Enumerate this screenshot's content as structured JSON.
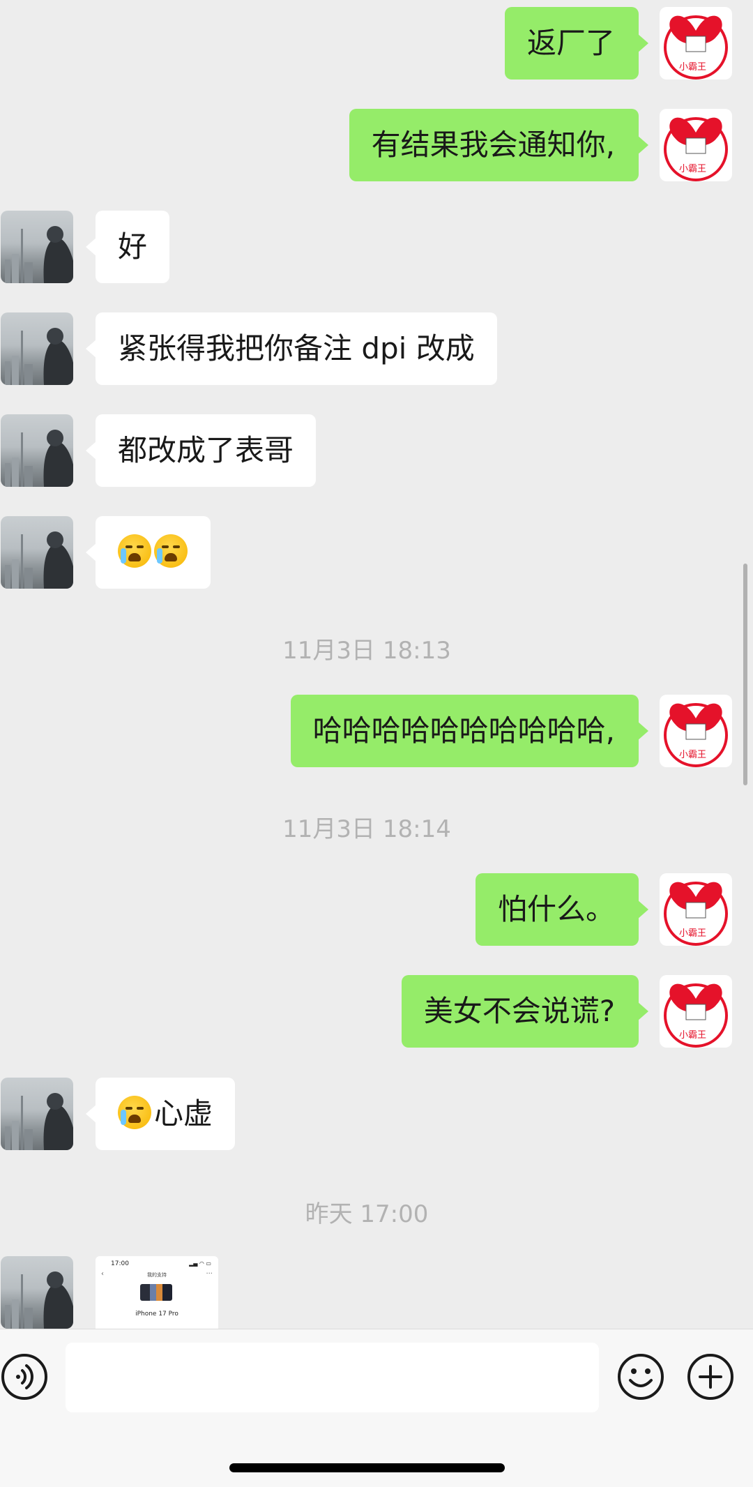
{
  "messages": [
    {
      "text": "返厂了"
    },
    {
      "text": "有结果我会通知你,"
    },
    {
      "text": "好"
    },
    {
      "text": "紧张得我把你备注 dpi 改成"
    },
    {
      "text": "都改成了表哥"
    },
    {
      "text": "哈哈哈哈哈哈哈哈哈哈,"
    },
    {
      "text": "怕什么。"
    },
    {
      "text": "美女不会说谎?"
    },
    {
      "text": "心虚"
    }
  ],
  "timestamps": [
    "11月3日 18:13",
    "11月3日 18:14",
    "昨天 17:00"
  ],
  "self_avatar": {
    "text": "小霸王",
    "icon": "xiaobawang-logo-icon"
  },
  "peer_avatar": {
    "icon": "city-skyline-photo-icon"
  },
  "shared_card": {
    "time": "17:00",
    "title": "我的支持",
    "model": "iPhone 17 Pro"
  },
  "input": {
    "placeholder": ""
  },
  "colors": {
    "background": "#ededed",
    "self_bubble": "#95ec69",
    "peer_bubble": "#ffffff",
    "timestamp": "#b2b2b2",
    "logo_red": "#e5122a"
  }
}
